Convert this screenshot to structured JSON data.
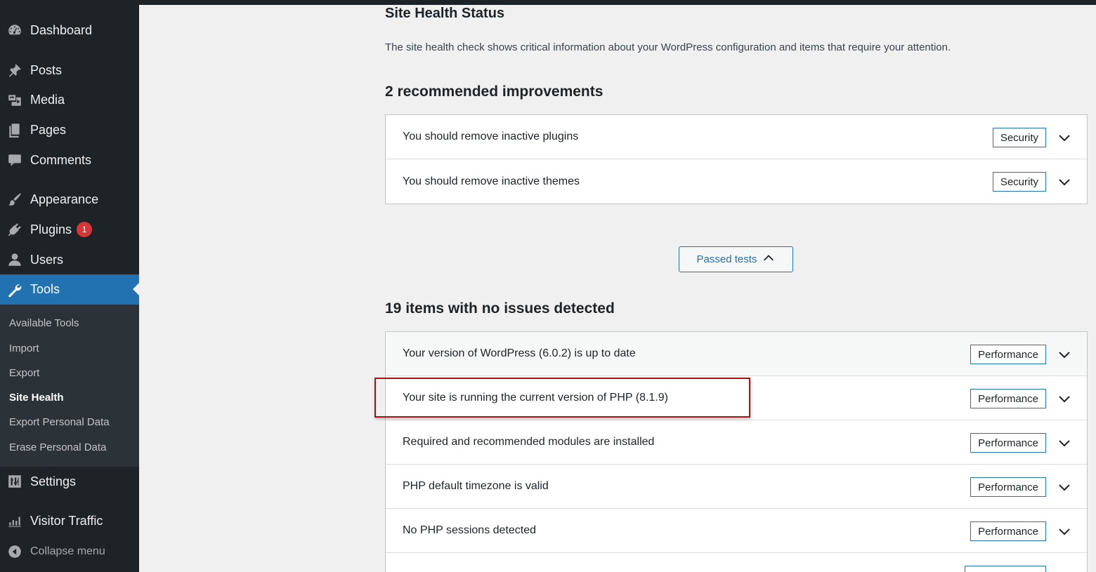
{
  "sidebar": {
    "items": [
      {
        "label": "Dashboard",
        "icon": "dashboard-icon"
      },
      {
        "label": "Posts",
        "icon": "pushpin-icon"
      },
      {
        "label": "Media",
        "icon": "media-icon"
      },
      {
        "label": "Pages",
        "icon": "pages-icon"
      },
      {
        "label": "Comments",
        "icon": "comment-icon"
      },
      {
        "label": "Appearance",
        "icon": "paintbrush-icon"
      },
      {
        "label": "Plugins",
        "icon": "plugin-icon",
        "badge": "1"
      },
      {
        "label": "Users",
        "icon": "user-icon"
      },
      {
        "label": "Tools",
        "icon": "wrench-icon",
        "active": true
      },
      {
        "label": "Settings",
        "icon": "settings-icon"
      },
      {
        "label": "Visitor Traffic",
        "icon": "chart-icon"
      }
    ],
    "submenu": [
      {
        "label": "Available Tools"
      },
      {
        "label": "Import"
      },
      {
        "label": "Export"
      },
      {
        "label": "Site Health",
        "current": true
      },
      {
        "label": "Export Personal Data"
      },
      {
        "label": "Erase Personal Data"
      }
    ],
    "collapse_label": "Collapse menu"
  },
  "main": {
    "title": "Site Health Status",
    "description": "The site health check shows critical information about your WordPress configuration and items that require your attention.",
    "recommended_heading": "2 recommended improvements",
    "recommended": [
      {
        "label": "You should remove inactive plugins",
        "tag": "Security"
      },
      {
        "label": "You should remove inactive themes",
        "tag": "Security"
      }
    ],
    "passed_button": "Passed tests",
    "passed_heading": "19 items with no issues detected",
    "passed": [
      {
        "label": "Your version of WordPress (6.0.2) is up to date",
        "tag": "Performance"
      },
      {
        "label": "Your site is running the current version of PHP (8.1.9)",
        "tag": "Performance"
      },
      {
        "label": "Required and recommended modules are installed",
        "tag": "Performance"
      },
      {
        "label": "PHP default timezone is valid",
        "tag": "Performance"
      },
      {
        "label": "No PHP sessions detected",
        "tag": "Performance"
      },
      {
        "label": "",
        "tag": ""
      }
    ]
  },
  "colors": {
    "sidebar_bg": "#1d2327",
    "submenu_bg": "#2c3338",
    "accent": "#2271b1",
    "badge": "#d63638",
    "highlight_border": "#a31515"
  }
}
